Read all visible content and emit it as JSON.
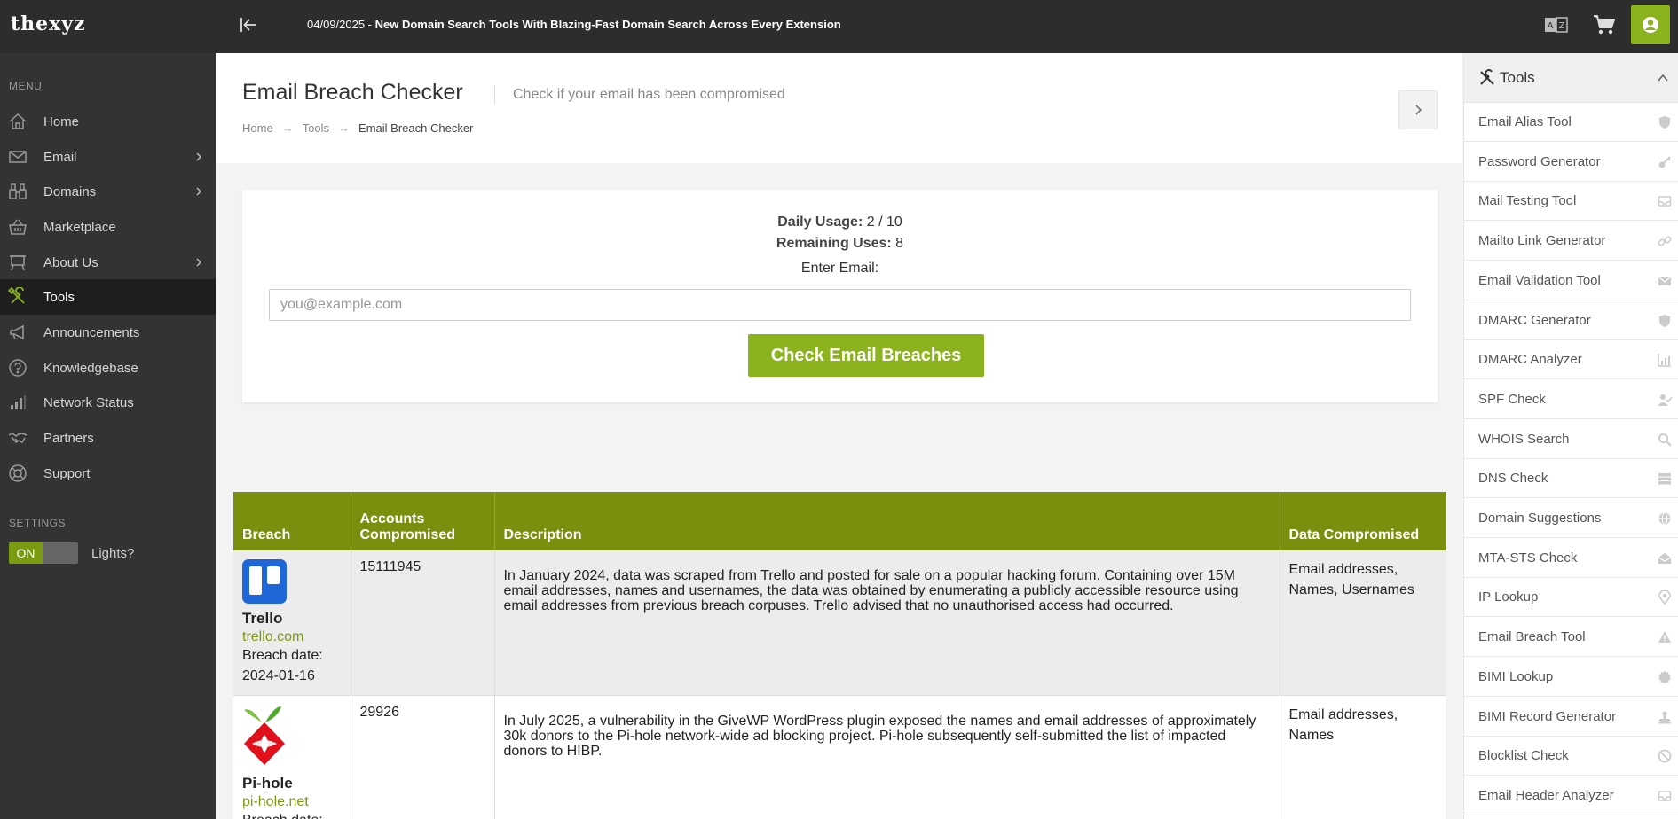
{
  "brand": {
    "logo_text": "thexyz"
  },
  "topbar": {
    "announcement_date": "04/09/2025 - ",
    "announcement_text": "New Domain Search Tools With Blazing-Fast Domain Search Across Every Extension"
  },
  "sidebar": {
    "menu_heading": "MENU",
    "settings_heading": "SETTINGS",
    "items": [
      {
        "label": "Home",
        "icon": "home-icon",
        "has_submenu": false,
        "active": false
      },
      {
        "label": "Email",
        "icon": "envelope-icon",
        "has_submenu": true,
        "active": false
      },
      {
        "label": "Domains",
        "icon": "binoculars-icon",
        "has_submenu": true,
        "active": false
      },
      {
        "label": "Marketplace",
        "icon": "basket-icon",
        "has_submenu": false,
        "active": false
      },
      {
        "label": "About Us",
        "icon": "board-icon",
        "has_submenu": true,
        "active": false
      },
      {
        "label": "Tools",
        "icon": "tools-icon",
        "has_submenu": false,
        "active": true
      },
      {
        "label": "Announcements",
        "icon": "megaphone-icon",
        "has_submenu": false,
        "active": false
      },
      {
        "label": "Knowledgebase",
        "icon": "question-icon",
        "has_submenu": false,
        "active": false
      },
      {
        "label": "Network Status",
        "icon": "signal-bars-icon",
        "has_submenu": false,
        "active": false
      },
      {
        "label": "Partners",
        "icon": "handshake-icon",
        "has_submenu": false,
        "active": false
      },
      {
        "label": "Support",
        "icon": "lifebuoy-icon",
        "has_submenu": false,
        "active": false
      }
    ],
    "toggle_on_label": "ON",
    "lights_label": "Lights?"
  },
  "page": {
    "title": "Email Breach Checker",
    "subtitle": "Check if your email has been compromised",
    "breadcrumb": [
      "Home",
      "Tools",
      "Email Breach Checker"
    ]
  },
  "checker": {
    "daily_usage_label": "Daily Usage:",
    "daily_usage_value": " 2 / 10",
    "remaining_label": "Remaining Uses:",
    "remaining_value": " 8",
    "email_label": "Enter Email:",
    "email_placeholder": "you@example.com",
    "email_value": "",
    "button_label": "Check Email Breaches"
  },
  "table": {
    "headers": [
      "Breach",
      "Accounts Compromised",
      "Description",
      "Data Compromised"
    ],
    "rows": [
      {
        "name": "Trello",
        "domain": "trello.com",
        "breach_date_label": "Breach date:",
        "breach_date": "2024-01-16",
        "accounts": "15111945",
        "description": "In January 2024, data was scraped from Trello and posted for sale on a popular hacking forum. Containing over 15M email addresses, names and usernames, the data was obtained by enumerating a publicly accessible resource using email addresses from previous breach corpuses. Trello advised that no unauthorised access had occurred.",
        "data_compromised": "Email addresses, Names, Usernames"
      },
      {
        "name": "Pi-hole",
        "domain": "pi-hole.net",
        "breach_date_label": "Breach date:",
        "breach_date": "",
        "accounts": "29926",
        "description": "In July 2025, a vulnerability in the GiveWP WordPress plugin exposed the names and email addresses of approximately 30k donors to the Pi-hole network-wide ad blocking project. Pi-hole subsequently self-submitted the list of impacted donors to HIBP.",
        "data_compromised": "Email addresses, Names"
      }
    ]
  },
  "tools_panel": {
    "title": "Tools",
    "items": [
      {
        "label": "Email Alias Tool",
        "icon": "shield-icon"
      },
      {
        "label": "Password Generator",
        "icon": "key-icon"
      },
      {
        "label": "Mail Testing Tool",
        "icon": "inbox-icon"
      },
      {
        "label": "Mailto Link Generator",
        "icon": "link-icon"
      },
      {
        "label": "Email Validation Tool",
        "icon": "envelope-icon"
      },
      {
        "label": "DMARC Generator",
        "icon": "shield-icon"
      },
      {
        "label": "DMARC Analyzer",
        "icon": "chart-icon"
      },
      {
        "label": "SPF Check",
        "icon": "user-check-icon"
      },
      {
        "label": "WHOIS Search",
        "icon": "search-icon"
      },
      {
        "label": "DNS Check",
        "icon": "server-icon"
      },
      {
        "label": "Domain Suggestions",
        "icon": "globe-icon"
      },
      {
        "label": "MTA-STS Check",
        "icon": "envelope-open-icon"
      },
      {
        "label": "IP Lookup",
        "icon": "map-pin-icon"
      },
      {
        "label": "Email Breach Tool",
        "icon": "warning-icon"
      },
      {
        "label": "BIMI Lookup",
        "icon": "badge-icon"
      },
      {
        "label": "BIMI Record Generator",
        "icon": "stamp-icon"
      },
      {
        "label": "Blocklist Check",
        "icon": "ban-icon"
      },
      {
        "label": "Email Header Analyzer",
        "icon": "inbox-icon"
      }
    ]
  },
  "colors": {
    "accent": "#8ab31e",
    "table_header": "#7a8f0e",
    "dark_bg": "#2d2d2d",
    "sidebar_bg": "#333333"
  }
}
